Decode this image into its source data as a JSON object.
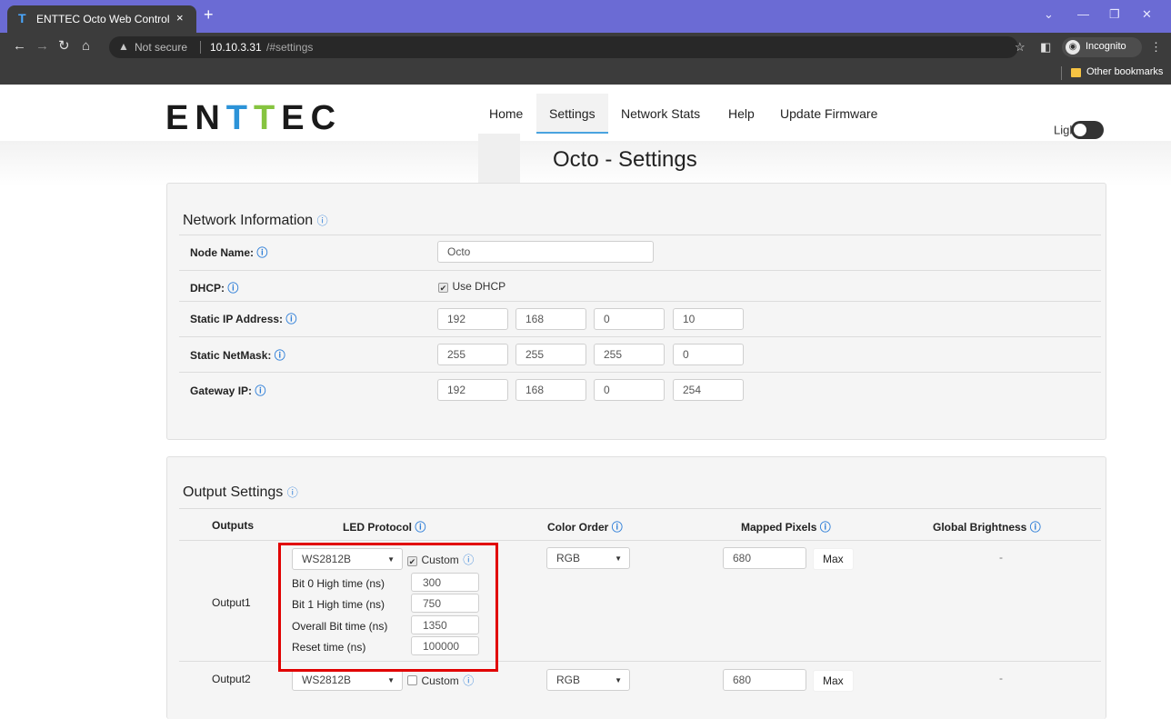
{
  "browser": {
    "tab_title": "ENTTEC Octo Web Control",
    "tab_favicon": "T",
    "tab_close": "×",
    "new_tab": "+",
    "security_text": "Not secure",
    "url_host": "10.10.3.31",
    "url_path": "/#settings",
    "incognito_label": "Incognito",
    "bookmark_folder": "Other bookmarks"
  },
  "header": {
    "logo": [
      "EN",
      "T",
      "T",
      "EC"
    ],
    "nav": {
      "home": "Home",
      "settings": "Settings",
      "network_stats": "Network Stats",
      "help": "Help",
      "update_firmware": "Update Firmware"
    },
    "theme_label": "Light"
  },
  "page_title": "Octo - Settings",
  "info_glyph": "ⓘ",
  "network": {
    "title": "Network Information",
    "node_name_label": "Node Name",
    "node_name_value": "Octo",
    "dhcp_label": "DHCP",
    "dhcp_checkbox_label": "Use DHCP",
    "dhcp_checked": true,
    "static_ip_label": "Static IP Address",
    "static_ip": [
      "192",
      "168",
      "0",
      "10"
    ],
    "netmask_label": "Static NetMask",
    "netmask": [
      "255",
      "255",
      "255",
      "0"
    ],
    "gateway_label": "Gateway IP",
    "gateway": [
      "192",
      "168",
      "0",
      "254"
    ]
  },
  "output_settings": {
    "title": "Output Settings",
    "columns": {
      "outputs": "Outputs",
      "led_protocol": "LED Protocol",
      "color_order": "Color Order",
      "mapped_pixels": "Mapped Pixels",
      "global_brightness": "Global Brightness"
    },
    "rows": [
      {
        "name": "Output1",
        "protocol": "WS2812B",
        "custom_label": "Custom",
        "custom_checked": true,
        "timing": {
          "bit0_label": "Bit 0 High time (ns)",
          "bit0": "300",
          "bit1_label": "Bit 1 High time (ns)",
          "bit1": "750",
          "overall_label": "Overall Bit time (ns)",
          "overall": "1350",
          "reset_label": "Reset time (ns)",
          "reset": "100000"
        },
        "color_order": "RGB",
        "mapped_pixels": "680",
        "max_label": "Max",
        "brightness": "-"
      },
      {
        "name": "Output2",
        "protocol": "WS2812B",
        "custom_label": "Custom",
        "custom_checked": false,
        "color_order": "RGB",
        "mapped_pixels": "680",
        "max_label": "Max",
        "brightness": "-"
      }
    ]
  },
  "colors": {
    "tabbar": "#6b6bd4",
    "chrome": "#3c3c3c",
    "accent_blue": "#2c93d8",
    "accent_green": "#86c440",
    "info_icon": "#2f7fd8",
    "highlight_red": "#e10000"
  }
}
